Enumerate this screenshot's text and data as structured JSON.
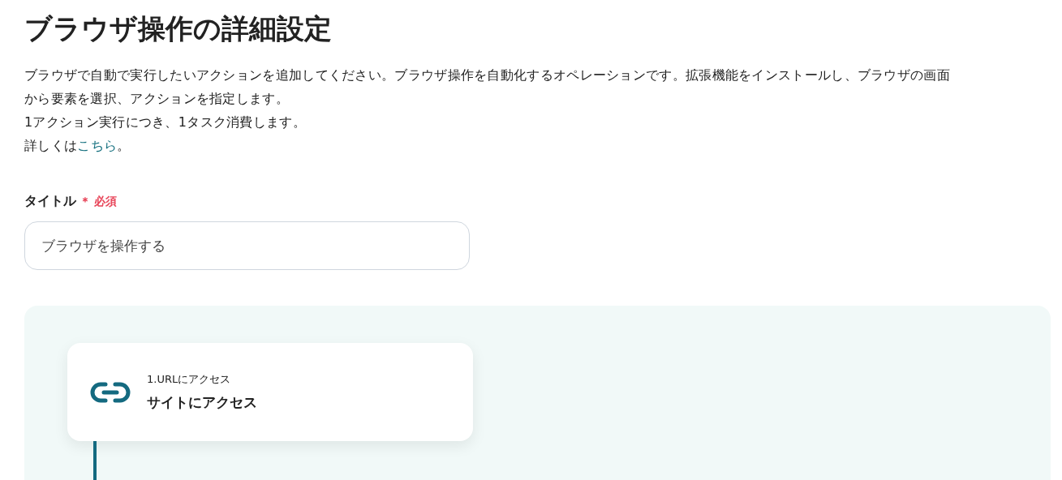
{
  "heading": "ブラウザ操作の詳細設定",
  "description_lines": [
    "ブラウザで自動で実行したいアクションを追加してください。ブラウザ操作を自動化するオペレーションです。拡張機能をインストールし、ブラウザの画面",
    "から要素を選択、アクションを指定します。",
    "1アクション実行につき、1タスク消費します。"
  ],
  "more_info": {
    "prefix": "詳しくは",
    "link": "こちら",
    "suffix": "。"
  },
  "title_field": {
    "label": "タイトル",
    "required_mark": "＊",
    "required_text": "必須",
    "value": "ブラウザを操作する"
  },
  "actions": [
    {
      "kind": "url",
      "step": "1.URLにアクセス",
      "name": "サイトにアクセス"
    }
  ]
}
